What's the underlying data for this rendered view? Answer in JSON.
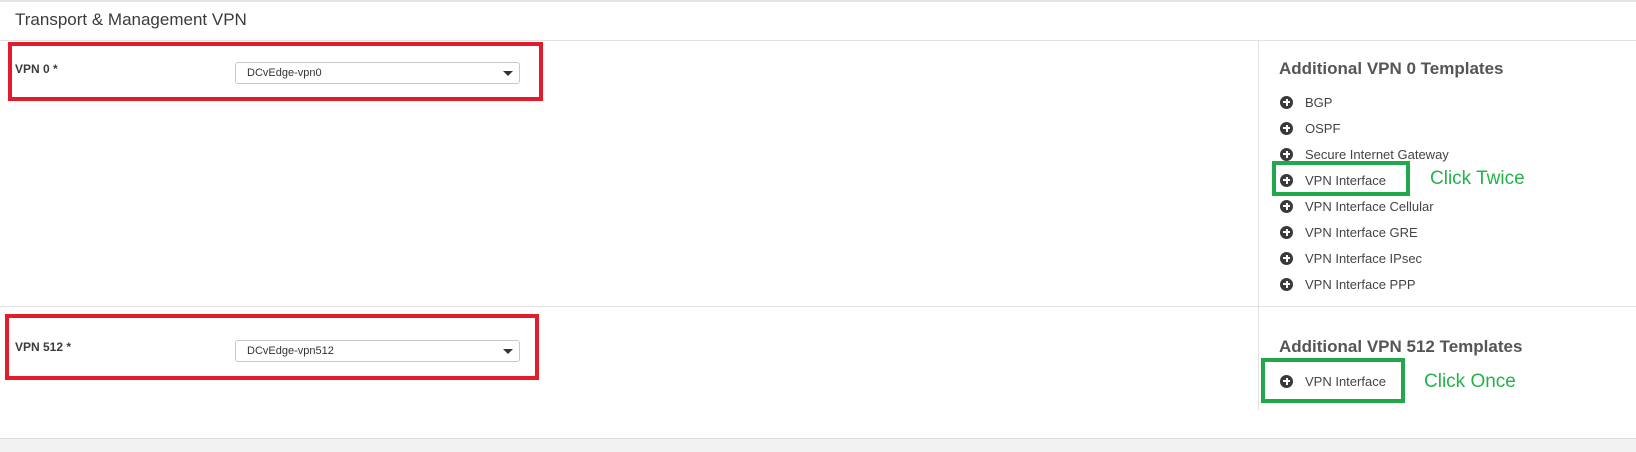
{
  "section": {
    "title": "Transport & Management VPN"
  },
  "vpn0": {
    "label": "VPN 0 *",
    "selected": "DCvEdge-vpn0",
    "panel_title": "Additional VPN 0 Templates",
    "templates": [
      "BGP",
      "OSPF",
      "Secure Internet Gateway",
      "VPN Interface",
      "VPN Interface Cellular",
      "VPN Interface GRE",
      "VPN Interface IPsec",
      "VPN Interface PPP"
    ],
    "annotation": "Click Twice"
  },
  "vpn512": {
    "label": "VPN 512 *",
    "selected": "DCvEdge-vpn512",
    "panel_title": "Additional VPN 512 Templates",
    "templates": [
      "VPN Interface"
    ],
    "annotation": "Click Once"
  },
  "colors": {
    "highlight_red": "#e21c2a",
    "highlight_green": "#22a84a",
    "annotation_text": "#24b34b"
  },
  "icons": {
    "add": "plus-circle-icon",
    "dropdown": "chevron-down-icon"
  }
}
